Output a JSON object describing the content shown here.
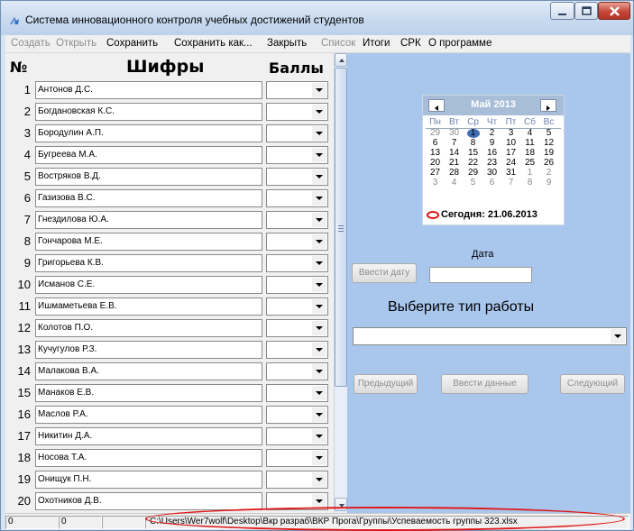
{
  "window": {
    "title": "Система инновационного контроля учебных достижений студентов"
  },
  "menu": [
    {
      "label": "Создать",
      "enabled": false
    },
    {
      "label": "Открыть",
      "enabled": false
    },
    {
      "label": "Сохранить",
      "enabled": true
    },
    {
      "label": "Сохранить как...",
      "enabled": true
    },
    {
      "label": "Закрыть",
      "enabled": true
    },
    {
      "label": "Список",
      "enabled": false
    },
    {
      "label": "Итоги",
      "enabled": true
    },
    {
      "label": "СРК",
      "enabled": true
    },
    {
      "label": "О программе",
      "enabled": true
    }
  ],
  "table": {
    "header_num": "№",
    "header_codes": "Шифры",
    "header_scores": "Баллы",
    "rows": [
      {
        "num": "1",
        "name": "Антонов Д.С.",
        "score": ""
      },
      {
        "num": "2",
        "name": "Богдановская К.С.",
        "score": ""
      },
      {
        "num": "3",
        "name": "Бородулин А.П.",
        "score": ""
      },
      {
        "num": "4",
        "name": "Бугреева М.А.",
        "score": ""
      },
      {
        "num": "5",
        "name": "Востряков В.Д.",
        "score": ""
      },
      {
        "num": "6",
        "name": "Газизова В.С.",
        "score": ""
      },
      {
        "num": "7",
        "name": "Гнездилова Ю.А.",
        "score": ""
      },
      {
        "num": "8",
        "name": "Гончарова М.Е.",
        "score": ""
      },
      {
        "num": "9",
        "name": "Григорьева К.В.",
        "score": ""
      },
      {
        "num": "10",
        "name": "Исманов С.Е.",
        "score": ""
      },
      {
        "num": "11",
        "name": "Ишмаметьева Е.В.",
        "score": ""
      },
      {
        "num": "12",
        "name": "Колотов П.О.",
        "score": ""
      },
      {
        "num": "13",
        "name": "Кучугулов Р.З.",
        "score": ""
      },
      {
        "num": "14",
        "name": "Малакова В.А.",
        "score": ""
      },
      {
        "num": "15",
        "name": "Манаков Е.В.",
        "score": ""
      },
      {
        "num": "16",
        "name": "Маслов Р.А.",
        "score": ""
      },
      {
        "num": "17",
        "name": "Никитин Д.А.",
        "score": ""
      },
      {
        "num": "18",
        "name": "Носова Т.А.",
        "score": ""
      },
      {
        "num": "19",
        "name": "Онищук П.Н.",
        "score": ""
      },
      {
        "num": "20",
        "name": "Охотников Д.В.",
        "score": ""
      }
    ]
  },
  "calendar": {
    "month_label": "Май 2013",
    "weekdays": [
      "Пн",
      "Вт",
      "Ср",
      "Чт",
      "Пт",
      "Сб",
      "Вс"
    ],
    "weeks": [
      [
        {
          "d": "29",
          "o": true
        },
        {
          "d": "30",
          "o": true
        },
        {
          "d": "1",
          "o": false,
          "sel": true
        },
        {
          "d": "2",
          "o": false
        },
        {
          "d": "3",
          "o": false
        },
        {
          "d": "4",
          "o": false
        },
        {
          "d": "5",
          "o": false
        }
      ],
      [
        {
          "d": "6",
          "o": false
        },
        {
          "d": "7",
          "o": false
        },
        {
          "d": "8",
          "o": false
        },
        {
          "d": "9",
          "o": false
        },
        {
          "d": "10",
          "o": false
        },
        {
          "d": "11",
          "o": false
        },
        {
          "d": "12",
          "o": false
        }
      ],
      [
        {
          "d": "13",
          "o": false
        },
        {
          "d": "14",
          "o": false
        },
        {
          "d": "15",
          "o": false
        },
        {
          "d": "16",
          "o": false
        },
        {
          "d": "17",
          "o": false
        },
        {
          "d": "18",
          "o": false
        },
        {
          "d": "19",
          "o": false
        }
      ],
      [
        {
          "d": "20",
          "o": false
        },
        {
          "d": "21",
          "o": false
        },
        {
          "d": "22",
          "o": false
        },
        {
          "d": "23",
          "o": false
        },
        {
          "d": "24",
          "o": false
        },
        {
          "d": "25",
          "o": false
        },
        {
          "d": "26",
          "o": false
        }
      ],
      [
        {
          "d": "27",
          "o": false
        },
        {
          "d": "28",
          "o": false
        },
        {
          "d": "29",
          "o": false
        },
        {
          "d": "30",
          "o": false
        },
        {
          "d": "31",
          "o": false
        },
        {
          "d": "1",
          "o": true
        },
        {
          "d": "2",
          "o": true
        }
      ],
      [
        {
          "d": "3",
          "o": true
        },
        {
          "d": "4",
          "o": true
        },
        {
          "d": "5",
          "o": true
        },
        {
          "d": "6",
          "o": true
        },
        {
          "d": "7",
          "o": true
        },
        {
          "d": "8",
          "o": true
        },
        {
          "d": "9",
          "o": true
        }
      ]
    ],
    "today_label": "Сегодня: 21.06.2013"
  },
  "date_section": {
    "label": "Дата",
    "enter_date_button": "Ввести дату",
    "date_value": ""
  },
  "work_section": {
    "title": "Выберите тип работы",
    "selected": ""
  },
  "nav_buttons": {
    "prev": "Предыдущий",
    "enter": "Ввести данные",
    "next": "Следующий"
  },
  "status": {
    "cell1": "0",
    "cell2": "0",
    "path": "C:\\Users\\Wer7wolf\\Desktop\\Вкр разраб\\ВКР Прога\\Группы\\Успеваемость группы 323.xlsx"
  },
  "colors": {
    "panel_bg": "#a9c6ed",
    "annotation": "#e01818"
  }
}
